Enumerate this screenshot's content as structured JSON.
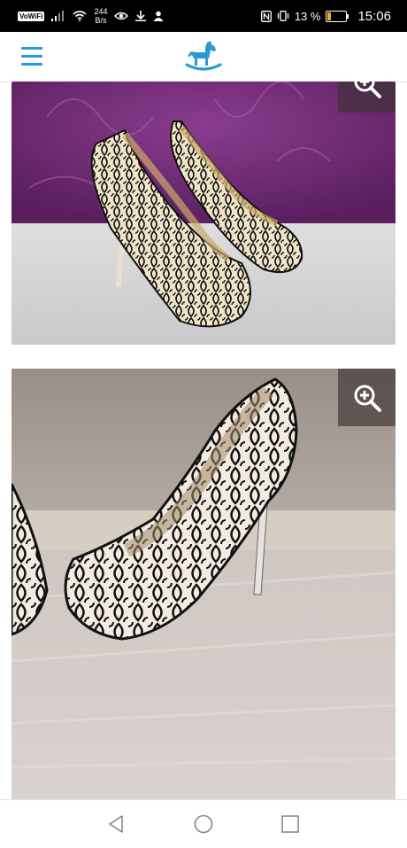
{
  "status_bar": {
    "vowifi": "VoWiFi",
    "net_speed_value": "244",
    "net_speed_unit": "B/s",
    "battery": "13 %",
    "time": "15:06"
  },
  "header": {
    "menu_icon": "hamburger-icon",
    "logo_icon": "rocking-horse-icon"
  },
  "gallery": {
    "images": [
      {
        "subject": "black lace platform high heels on purple background",
        "zoom_icon": "zoom-in-icon"
      },
      {
        "subject": "black lace platform high heel close-up on wooden floor",
        "zoom_icon": "zoom-in-icon"
      }
    ]
  },
  "nav": {
    "back_icon": "back-triangle-icon",
    "home_icon": "home-circle-icon",
    "recents_icon": "recents-square-icon"
  },
  "colors": {
    "accent": "#2a9ad3",
    "status_bar": "#000000",
    "battery_low": "#f5a623"
  }
}
